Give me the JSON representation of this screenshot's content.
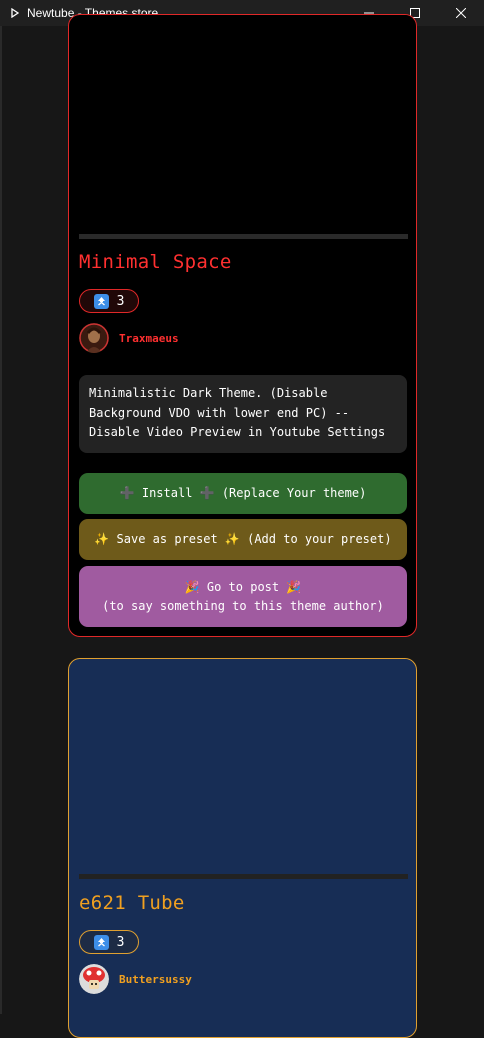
{
  "window": {
    "title": "Newtube - Themes store",
    "controls": [
      "minimize-icon",
      "maximize-icon",
      "close-icon"
    ]
  },
  "themes": [
    {
      "title": "Minimal Space",
      "votes": "3",
      "vote_icon": "up-arrow-icon",
      "author": "Traxmaeus",
      "description": "Minimalistic Dark Theme. (Disable\nBackground VDO with lower end PC) --\nDisable Video Preview in Youtube Settings",
      "buttons": {
        "install": "➕ Install ➕ (Replace Your theme)",
        "preset": "✨ Save as preset ✨ (Add to your preset)",
        "post": "🎉 Go to post 🎉\n(to say something to this theme author)"
      },
      "colors": {
        "accent": "#ff3030",
        "border": "#e02828",
        "background": "#000000"
      }
    },
    {
      "title": "e621 Tube",
      "votes": "3",
      "vote_icon": "up-arrow-icon",
      "author": "Buttersussy",
      "colors": {
        "accent": "#f0a020",
        "border": "#e0a030",
        "background": "#172d55"
      }
    }
  ]
}
